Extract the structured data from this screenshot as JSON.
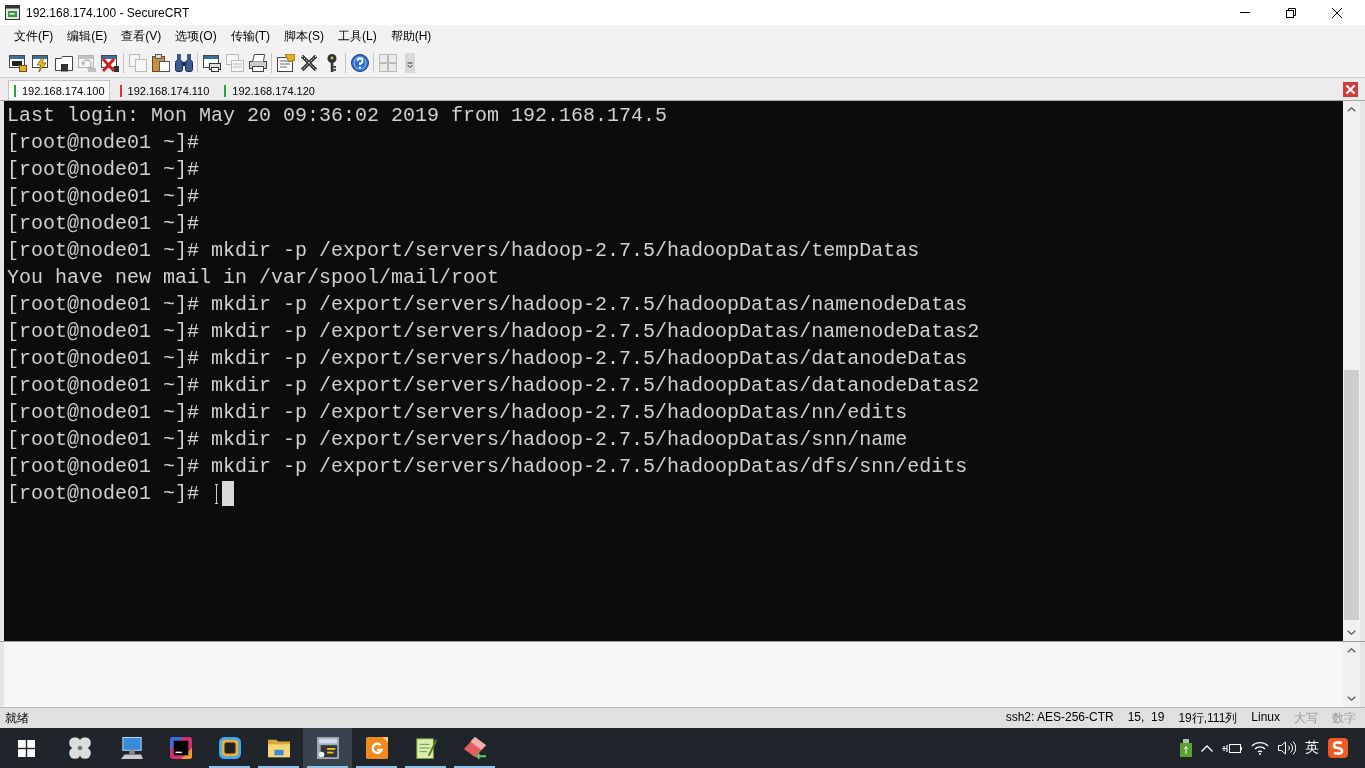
{
  "window": {
    "title": "192.168.174.100 - SecureCRT"
  },
  "menu": [
    "文件(F)",
    "编辑(E)",
    "查看(V)",
    "选项(O)",
    "传输(T)",
    "脚本(S)",
    "工具(L)",
    "帮助(H)"
  ],
  "toolbar": {
    "groups": [
      {
        "buttons": [
          {
            "kind": "connect",
            "disabled": false
          },
          {
            "kind": "quick-connect",
            "disabled": false
          },
          {
            "kind": "connect-tab",
            "disabled": false
          },
          {
            "kind": "reconnect",
            "disabled": true
          },
          {
            "kind": "disconnect",
            "disabled": false
          }
        ]
      },
      {
        "buttons": [
          {
            "kind": "copy",
            "disabled": true
          },
          {
            "kind": "paste",
            "disabled": false
          },
          {
            "kind": "find",
            "disabled": false
          }
        ]
      },
      {
        "buttons": [
          {
            "kind": "print-screen",
            "disabled": false
          },
          {
            "kind": "log",
            "disabled": true
          },
          {
            "kind": "print",
            "disabled": false
          }
        ]
      },
      {
        "buttons": [
          {
            "kind": "session-options",
            "disabled": false
          },
          {
            "kind": "global-options",
            "disabled": false
          },
          {
            "kind": "keymap",
            "disabled": false
          }
        ]
      },
      {
        "buttons": [
          {
            "kind": "help",
            "disabled": false
          }
        ]
      },
      {
        "buttons": [
          {
            "kind": "tiles",
            "disabled": true
          }
        ]
      }
    ]
  },
  "tabs": [
    {
      "label": "192.168.174.100",
      "selected": true,
      "connected": true
    },
    {
      "label": "192.168.174.110",
      "selected": false,
      "connected": false
    },
    {
      "label": "192.168.174.120",
      "selected": false,
      "connected": true
    }
  ],
  "terminal": {
    "lines": [
      "Last login: Mon May 20 09:36:02 2019 from 192.168.174.5",
      "[root@node01 ~]#",
      "[root@node01 ~]#",
      "[root@node01 ~]#",
      "[root@node01 ~]#",
      "[root@node01 ~]# mkdir -p /export/servers/hadoop-2.7.5/hadoopDatas/tempDatas",
      "You have new mail in /var/spool/mail/root",
      "[root@node01 ~]# mkdir -p /export/servers/hadoop-2.7.5/hadoopDatas/namenodeDatas",
      "[root@node01 ~]# mkdir -p /export/servers/hadoop-2.7.5/hadoopDatas/namenodeDatas2",
      "[root@node01 ~]# mkdir -p /export/servers/hadoop-2.7.5/hadoopDatas/datanodeDatas",
      "[root@node01 ~]# mkdir -p /export/servers/hadoop-2.7.5/hadoopDatas/datanodeDatas2",
      "[root@node01 ~]# mkdir -p /export/servers/hadoop-2.7.5/hadoopDatas/nn/edits",
      "[root@node01 ~]# mkdir -p /export/servers/hadoop-2.7.5/hadoopDatas/snn/name",
      "[root@node01 ~]# mkdir -p /export/servers/hadoop-2.7.5/hadoopDatas/dfs/snn/edits",
      "[root@node01 ~]#"
    ]
  },
  "status_bar": {
    "message": "就绪",
    "items": [
      {
        "text": "ssh2: AES-256-CTR",
        "disabled": false
      },
      {
        "text": "15,  19",
        "disabled": false
      },
      {
        "text": "19行,111列",
        "disabled": false
      },
      {
        "text": "Linux",
        "disabled": false
      },
      {
        "text": "大写",
        "disabled": true
      },
      {
        "text": "数字",
        "disabled": true
      }
    ]
  },
  "taskbar": {
    "apps": [
      {
        "kind": "start",
        "running": false,
        "selected": false
      },
      {
        "kind": "pinwheel",
        "running": false,
        "selected": false
      },
      {
        "kind": "computer",
        "running": false,
        "selected": false
      },
      {
        "kind": "code-editor",
        "running": false,
        "selected": false
      },
      {
        "kind": "virtual-machine",
        "running": true,
        "selected": false
      },
      {
        "kind": "folder",
        "running": true,
        "selected": false
      },
      {
        "kind": "terminal",
        "running": true,
        "selected": true
      },
      {
        "kind": "document",
        "running": true,
        "selected": false
      },
      {
        "kind": "notepad",
        "running": true,
        "selected": false
      },
      {
        "kind": "eraser",
        "running": true,
        "selected": false
      }
    ],
    "tray": {
      "language": "英"
    }
  }
}
